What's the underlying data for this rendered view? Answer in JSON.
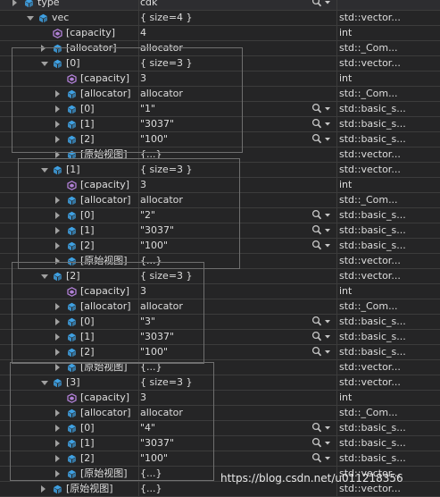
{
  "rows": [
    {
      "name": "type",
      "value": "cdk",
      "type": "",
      "indent": 0,
      "expander": "collapsed",
      "icon": "field-icon",
      "search": true
    },
    {
      "name": "vec",
      "value": "{ size=4 }",
      "type": "std::vector...",
      "indent": 1,
      "expander": "expanded",
      "icon": "field-icon",
      "search": false
    },
    {
      "name": "[capacity]",
      "value": "4",
      "type": "int",
      "indent": 2,
      "expander": "none",
      "icon": "property-icon",
      "search": false
    },
    {
      "name": "[allocator]",
      "value": "allocator",
      "type": "std::_Com...",
      "indent": 2,
      "expander": "collapsed",
      "icon": "field-icon",
      "search": false
    },
    {
      "name": "[0]",
      "value": "{ size=3 }",
      "type": "std::vector...",
      "indent": 2,
      "expander": "expanded",
      "icon": "field-icon",
      "search": false
    },
    {
      "name": "[capacity]",
      "value": "3",
      "type": "int",
      "indent": 3,
      "expander": "none",
      "icon": "property-icon",
      "search": false
    },
    {
      "name": "[allocator]",
      "value": "allocator",
      "type": "std::_Com...",
      "indent": 3,
      "expander": "collapsed",
      "icon": "field-icon",
      "search": false
    },
    {
      "name": "[0]",
      "value": "\"1\"",
      "type": "std::basic_s...",
      "indent": 3,
      "expander": "collapsed",
      "icon": "field-icon",
      "search": true
    },
    {
      "name": "[1]",
      "value": "\"3037\"",
      "type": "std::basic_s...",
      "indent": 3,
      "expander": "collapsed",
      "icon": "field-icon",
      "search": true
    },
    {
      "name": "[2]",
      "value": "\"100\"",
      "type": "std::basic_s...",
      "indent": 3,
      "expander": "collapsed",
      "icon": "field-icon",
      "search": true
    },
    {
      "name": "[原始视图]",
      "value": "{...}",
      "type": "std::vector...",
      "indent": 3,
      "expander": "collapsed",
      "icon": "field-icon",
      "search": false
    },
    {
      "name": "[1]",
      "value": "{ size=3 }",
      "type": "std::vector...",
      "indent": 2,
      "expander": "expanded",
      "icon": "field-icon",
      "search": false
    },
    {
      "name": "[capacity]",
      "value": "3",
      "type": "int",
      "indent": 3,
      "expander": "none",
      "icon": "property-icon",
      "search": false
    },
    {
      "name": "[allocator]",
      "value": "allocator",
      "type": "std::_Com...",
      "indent": 3,
      "expander": "collapsed",
      "icon": "field-icon",
      "search": false
    },
    {
      "name": "[0]",
      "value": "\"2\"",
      "type": "std::basic_s...",
      "indent": 3,
      "expander": "collapsed",
      "icon": "field-icon",
      "search": true
    },
    {
      "name": "[1]",
      "value": "\"3037\"",
      "type": "std::basic_s...",
      "indent": 3,
      "expander": "collapsed",
      "icon": "field-icon",
      "search": true
    },
    {
      "name": "[2]",
      "value": "\"100\"",
      "type": "std::basic_s...",
      "indent": 3,
      "expander": "collapsed",
      "icon": "field-icon",
      "search": true
    },
    {
      "name": "[原始视图]",
      "value": "{...}",
      "type": "std::vector...",
      "indent": 3,
      "expander": "collapsed",
      "icon": "field-icon",
      "search": false
    },
    {
      "name": "[2]",
      "value": "{ size=3 }",
      "type": "std::vector...",
      "indent": 2,
      "expander": "expanded",
      "icon": "field-icon",
      "search": false
    },
    {
      "name": "[capacity]",
      "value": "3",
      "type": "int",
      "indent": 3,
      "expander": "none",
      "icon": "property-icon",
      "search": false
    },
    {
      "name": "[allocator]",
      "value": "allocator",
      "type": "std::_Com...",
      "indent": 3,
      "expander": "collapsed",
      "icon": "field-icon",
      "search": false
    },
    {
      "name": "[0]",
      "value": "\"3\"",
      "type": "std::basic_s...",
      "indent": 3,
      "expander": "collapsed",
      "icon": "field-icon",
      "search": true
    },
    {
      "name": "[1]",
      "value": "\"3037\"",
      "type": "std::basic_s...",
      "indent": 3,
      "expander": "collapsed",
      "icon": "field-icon",
      "search": true
    },
    {
      "name": "[2]",
      "value": "\"100\"",
      "type": "std::basic_s...",
      "indent": 3,
      "expander": "collapsed",
      "icon": "field-icon",
      "search": true
    },
    {
      "name": "[原始视图]",
      "value": "{...}",
      "type": "std::vector...",
      "indent": 3,
      "expander": "collapsed",
      "icon": "field-icon",
      "search": false
    },
    {
      "name": "[3]",
      "value": "{ size=3 }",
      "type": "std::vector...",
      "indent": 2,
      "expander": "expanded",
      "icon": "field-icon",
      "search": false
    },
    {
      "name": "[capacity]",
      "value": "3",
      "type": "int",
      "indent": 3,
      "expander": "none",
      "icon": "property-icon",
      "search": false
    },
    {
      "name": "[allocator]",
      "value": "allocator",
      "type": "std::_Com...",
      "indent": 3,
      "expander": "collapsed",
      "icon": "field-icon",
      "search": false
    },
    {
      "name": "[0]",
      "value": "\"4\"",
      "type": "std::basic_s...",
      "indent": 3,
      "expander": "collapsed",
      "icon": "field-icon",
      "search": true
    },
    {
      "name": "[1]",
      "value": "\"3037\"",
      "type": "std::basic_s...",
      "indent": 3,
      "expander": "collapsed",
      "icon": "field-icon",
      "search": true
    },
    {
      "name": "[2]",
      "value": "\"100\"",
      "type": "std::basic_s...",
      "indent": 3,
      "expander": "collapsed",
      "icon": "field-icon",
      "search": true
    },
    {
      "name": "[原始视图]",
      "value": "{...}",
      "type": "std::vector...",
      "indent": 3,
      "expander": "collapsed",
      "icon": "field-icon",
      "search": false
    },
    {
      "name": "[原始视图]",
      "value": "{...}",
      "type": "std::vector...",
      "indent": 2,
      "expander": "collapsed",
      "icon": "field-icon",
      "search": false
    }
  ],
  "watermark": "https://blog.csdn.net/u011218356",
  "colors": {
    "background": "#252526",
    "text": "#dcdcdc",
    "field_icon": "#3fa1e3",
    "property_icon": "#b180d7",
    "annotation_box": "#6f6f6f"
  }
}
